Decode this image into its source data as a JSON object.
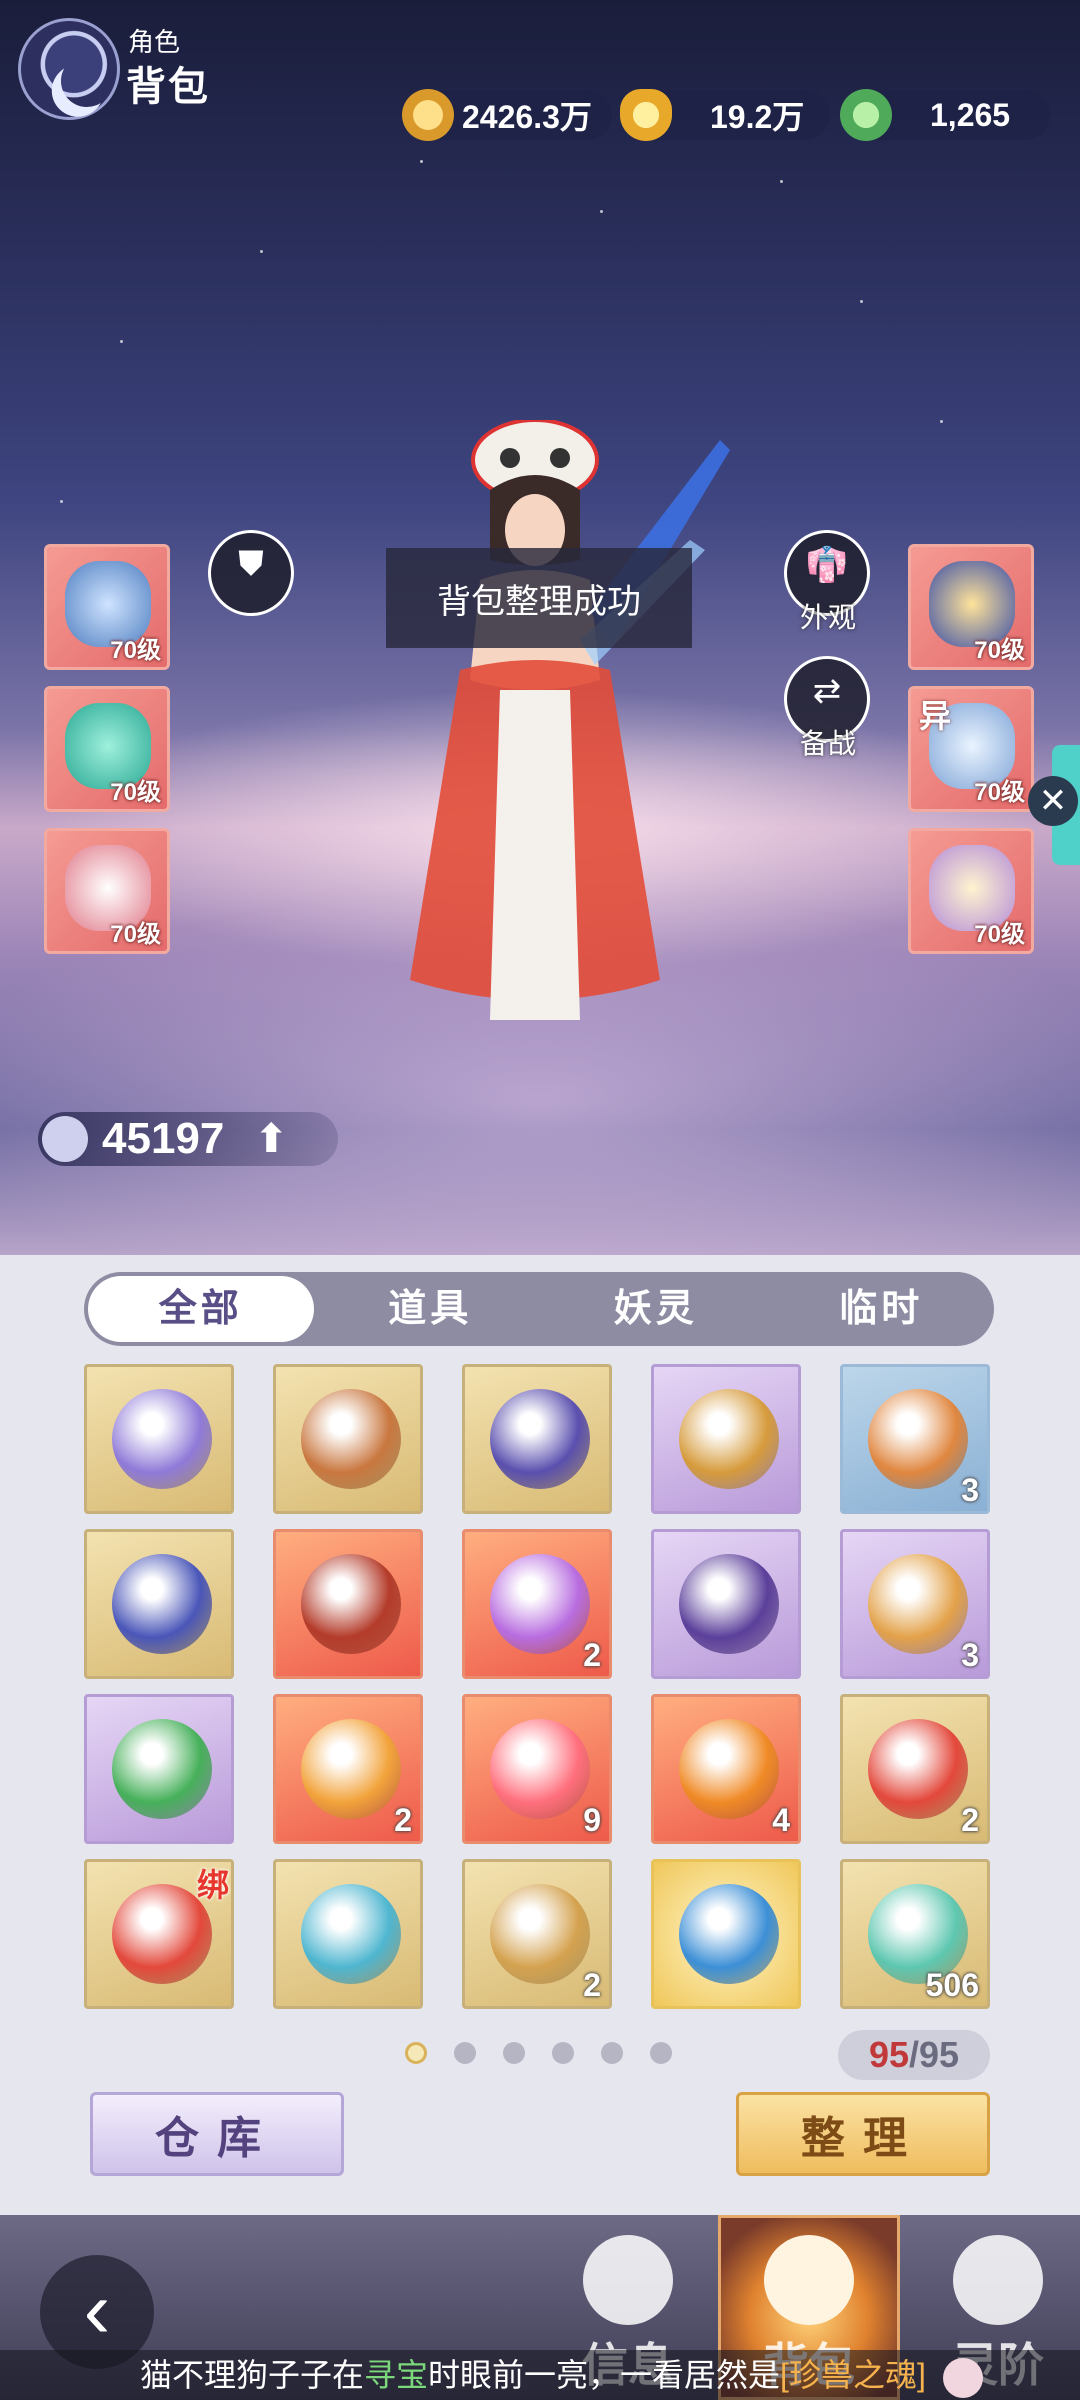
{
  "header": {
    "subtitle": "角色",
    "title": "背包"
  },
  "currencies": [
    {
      "name": "copper-coin-icon",
      "value": "2426.3万"
    },
    {
      "name": "gold-ingot-icon",
      "value": "19.2万"
    },
    {
      "name": "jade-dragon-icon",
      "value": "1,265"
    }
  ],
  "equipment_left": [
    {
      "name": "weapon",
      "level": "70级"
    },
    {
      "name": "necklace",
      "level": "70级"
    },
    {
      "name": "mask",
      "level": "70级"
    }
  ],
  "equipment_right": [
    {
      "name": "armor",
      "level": "70级",
      "tag": ""
    },
    {
      "name": "ring",
      "level": "70级",
      "tag": "异"
    },
    {
      "name": "boots",
      "level": "70级",
      "tag": ""
    }
  ],
  "buttons": {
    "appearance": "外观",
    "backup": "备战",
    "toast": "背包整理成功"
  },
  "power": "45197",
  "tabs": [
    "全部",
    "道具",
    "妖灵",
    "临时"
  ],
  "grid": [
    {
      "icon": "purple-pouch-icon",
      "color": "#8f7ad8",
      "frame": "gold",
      "count": ""
    },
    {
      "icon": "treasure-chest-icon",
      "color": "#c9773f",
      "frame": "gold",
      "count": ""
    },
    {
      "icon": "skill-book-icon",
      "color": "#5a4fae",
      "frame": "gold",
      "count": ""
    },
    {
      "icon": "gold-bag-icon",
      "color": "#d69b3c",
      "frame": "purple",
      "count": ""
    },
    {
      "icon": "star-sack-icon",
      "color": "#e08740",
      "frame": "blue",
      "count": "3"
    },
    {
      "icon": "gift-box-icon",
      "color": "#4a56b8",
      "frame": "gold",
      "count": ""
    },
    {
      "icon": "weapon-crate-icon",
      "color": "#b43b2a",
      "frame": "red",
      "count": ""
    },
    {
      "icon": "gem-pouch-icon",
      "color": "#b86de0",
      "frame": "red",
      "count": "2"
    },
    {
      "icon": "jewel-chest-icon",
      "color": "#5b3f9a",
      "frame": "purple",
      "count": ""
    },
    {
      "icon": "fate-token-icon",
      "color": "#e3a24a",
      "frame": "purple",
      "count": "3"
    },
    {
      "icon": "grant-card-icon",
      "color": "#46b05a",
      "frame": "purple",
      "count": ""
    },
    {
      "icon": "fire-amulet-icon",
      "color": "#f2a33b",
      "frame": "red",
      "count": "2"
    },
    {
      "icon": "flame-feather-icon",
      "color": "#ff6f7d",
      "frame": "red",
      "count": "9"
    },
    {
      "icon": "beast-orb-icon",
      "color": "#f08a26",
      "frame": "red",
      "count": "4"
    },
    {
      "icon": "crystal-ball-icon",
      "color": "#e3483b",
      "frame": "gold",
      "count": "2"
    },
    {
      "icon": "crystal-ball-bound-icon",
      "color": "#e3483b",
      "frame": "gold",
      "count": "",
      "bind": "绑"
    },
    {
      "icon": "cyan-orb-icon",
      "color": "#4fb6d0",
      "frame": "gold",
      "count": ""
    },
    {
      "icon": "scroll-icon",
      "color": "#d4a24f",
      "frame": "gold",
      "count": "2"
    },
    {
      "icon": "triple-gem-icon",
      "color": "#3c8fd6",
      "frame": "brightgold",
      "count": ""
    },
    {
      "icon": "potion-bottle-icon",
      "color": "#5ec7b0",
      "frame": "gold",
      "count": "506"
    }
  ],
  "pages": 6,
  "capacity": {
    "used": "95",
    "total": "/95"
  },
  "actions": {
    "warehouse": "仓库",
    "sort": "整理"
  },
  "nav": {
    "info": "信息",
    "bag": "背包",
    "rank": "灵阶"
  },
  "ticker": {
    "pre": "猫不理狗子子在",
    "hl1": "寻宝",
    "mid": "时眼前一亮，一看居然是",
    "hl2": "[珍兽之魂]"
  }
}
